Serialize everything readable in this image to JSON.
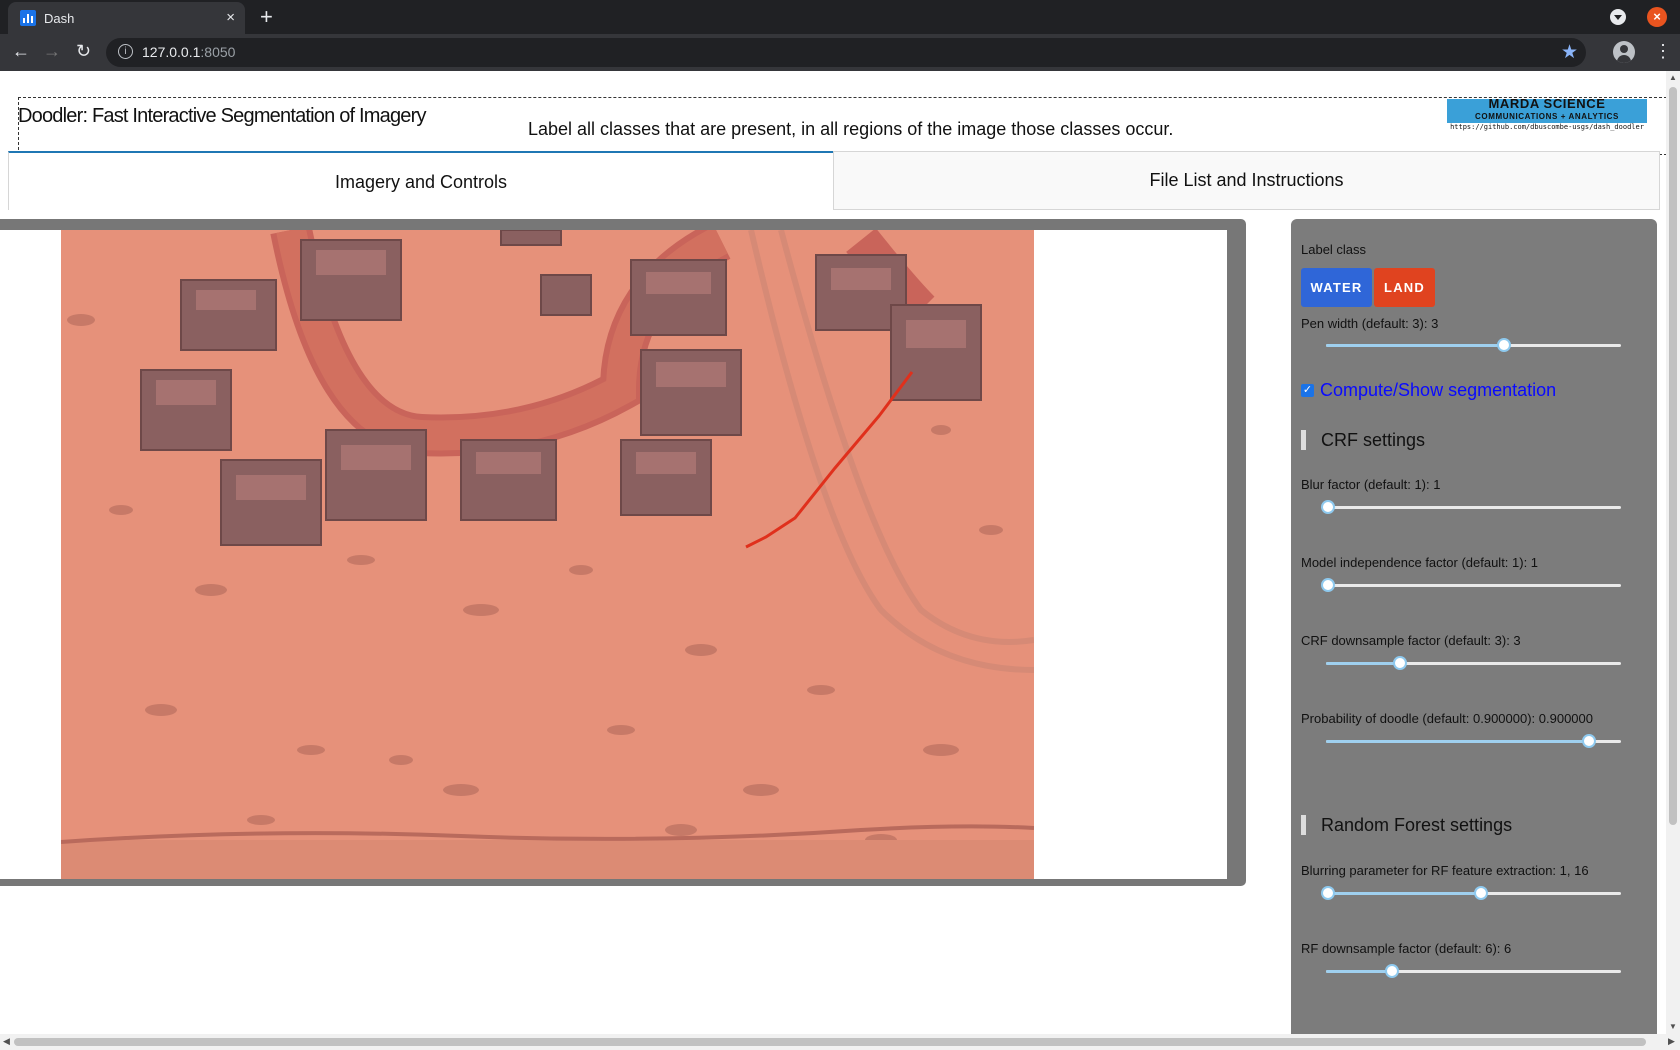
{
  "browser": {
    "tab_title": "Dash",
    "tab_close": "×",
    "new_tab": "+",
    "url_host": "127.0.0.1",
    "url_port": ":8050",
    "info_icon": "i",
    "star_icon": "★",
    "back": "←",
    "forward": "→",
    "reload": "↻",
    "menu": "⋮",
    "window_close": "×"
  },
  "header": {
    "title": "Doodler: Fast Interactive Segmentation of Imagery",
    "instructions": "Label all classes that are present, in all regions of the image those classes occur.",
    "logo_line1": "MARDA SCIENCE",
    "logo_line2": "COMMUNICATIONS + ANALYTICS",
    "logo_url": "https://github.com/dbuscombe-usgs/dash_doodler"
  },
  "tabs": [
    {
      "label": "Imagery and Controls",
      "active": true
    },
    {
      "label": "File List and Instructions",
      "active": false
    }
  ],
  "controls": {
    "label_class_title": "Label class",
    "class_buttons": [
      {
        "label": "WATER",
        "color": "#2f66d8"
      },
      {
        "label": "LAND",
        "color": "#e0431f"
      }
    ],
    "pen_width": {
      "label": "Pen width (default: 3): 3",
      "value": 3,
      "range": [
        1,
        5
      ]
    },
    "show_segmentation": {
      "label": "Compute/Show segmentation",
      "checked": true
    },
    "crf_section": "CRF settings",
    "blur_factor": {
      "label": "Blur factor (default: 1): 1",
      "value": 1
    },
    "model_independence": {
      "label": "Model independence factor (default: 1): 1",
      "value": 1
    },
    "crf_downsample": {
      "label": "CRF downsample factor (default: 3): 3",
      "value": 3
    },
    "prob_doodle": {
      "label": "Probability of doodle (default: 0.900000): 0.900000",
      "value": 0.9
    },
    "rf_section": "Random Forest settings",
    "rf_blur": {
      "label": "Blurring parameter for RF feature extraction: 1, 16",
      "values": [
        1,
        16
      ]
    },
    "rf_downsample": {
      "label": "RF downsample factor (default: 6): 6",
      "value": 6
    }
  },
  "colors": {
    "accent_tab": "#1f77b4",
    "water": "#2f66d8",
    "land": "#e0431f",
    "overlay": "#e0604a"
  }
}
